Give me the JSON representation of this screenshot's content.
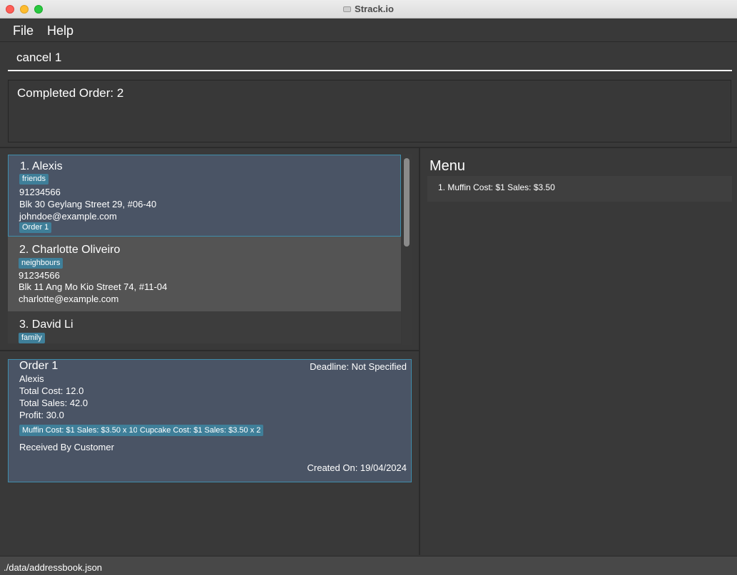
{
  "window": {
    "title": "Strack.io"
  },
  "menubar": {
    "file": "File",
    "help": "Help"
  },
  "command": {
    "value": "cancel 1"
  },
  "result": {
    "text": "Completed Order: 2"
  },
  "persons": [
    {
      "index_name": "1.  Alexis",
      "tag": "friends",
      "phone": "91234566",
      "address": "Blk 30 Geylang Street 29, #06-40",
      "email": "johndoe@example.com",
      "order_tag": "Order 1"
    },
    {
      "index_name": "2.  Charlotte Oliveiro",
      "tag": "neighbours",
      "phone": "91234566",
      "address": "Blk 11 Ang Mo Kio Street 74, #11-04",
      "email": "charlotte@example.com"
    },
    {
      "index_name": "3.  David Li",
      "tag": "family"
    }
  ],
  "order": {
    "title": "Order 1",
    "deadline": "Deadline: Not Specified",
    "customer": "Alexis",
    "total_cost": "Total Cost: 12.0",
    "total_sales": "Total Sales: 42.0",
    "profit": "Profit: 30.0",
    "items": [
      "Muffin Cost: $1 Sales: $3.50 x 10",
      "Cupcake Cost: $1 Sales: $3.50 x 2"
    ],
    "status": "Received By Customer",
    "created": "Created On: 19/04/2024"
  },
  "menu_panel": {
    "title": "Menu",
    "entries": [
      "1. Muffin  Cost: $1  Sales: $3.50"
    ]
  },
  "status": {
    "path": "./data/addressbook.json"
  },
  "colors": {
    "card_selected": "#4a5465",
    "card_border": "#3f8dab",
    "tag": "#3f7f99"
  }
}
